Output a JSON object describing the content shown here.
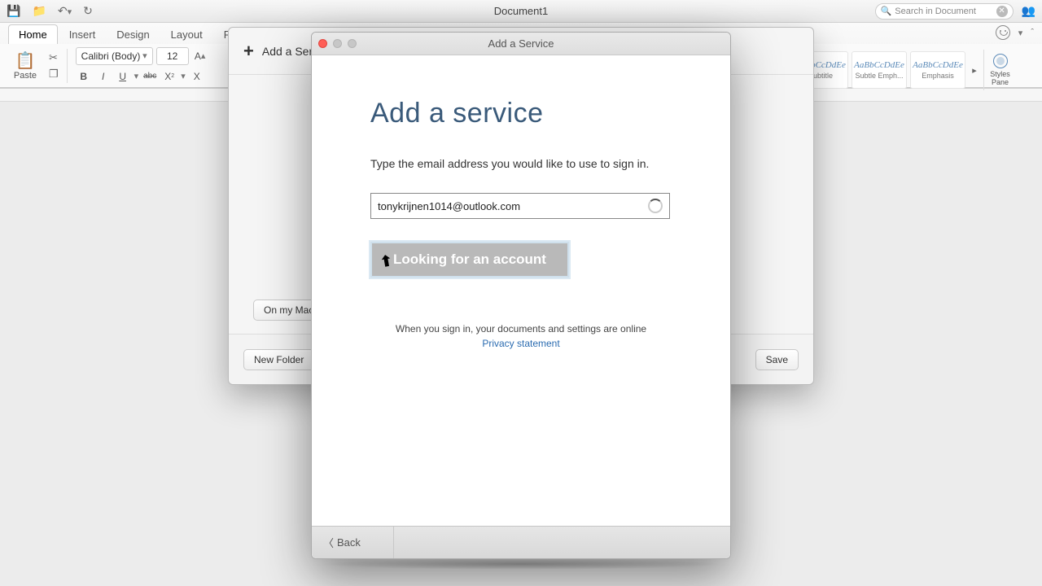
{
  "titlebar": {
    "document_title": "Document1",
    "search_placeholder": "Search in Document"
  },
  "ribbon": {
    "tabs": [
      "Home",
      "Insert",
      "Design",
      "Layout",
      "Refe"
    ],
    "active_tab": 0,
    "paste_label": "Paste",
    "font_name": "Calibri (Body)",
    "font_size": "12",
    "buttons": {
      "bold": "B",
      "italic": "I",
      "underline": "U",
      "strike": "abc",
      "sub": "X",
      "sup": "X"
    },
    "styles": [
      {
        "sample": "AaBbCcDdEe",
        "label": "Subtitle"
      },
      {
        "sample": "AaBbCcDdEe",
        "label": "Subtle Emph..."
      },
      {
        "sample": "AaBbCcDdEe",
        "label": "Emphasis"
      }
    ],
    "styles_pane": {
      "line1": "Styles",
      "line2": "Pane"
    }
  },
  "under_dialog": {
    "add_service_label": "Add a Service",
    "on_my_mac_label": "On my Mac",
    "new_folder_label": "New Folder",
    "save_label": "Save"
  },
  "front_dialog": {
    "window_title": "Add a Service",
    "heading": "Add a service",
    "description": "Type the email address you would like to use to sign in.",
    "email_value": "tonykrijnen1014@outlook.com",
    "looking_label": "Looking for an account",
    "note": "When you sign in, your documents and settings are online",
    "privacy_label": "Privacy statement",
    "back_label": "Back"
  }
}
